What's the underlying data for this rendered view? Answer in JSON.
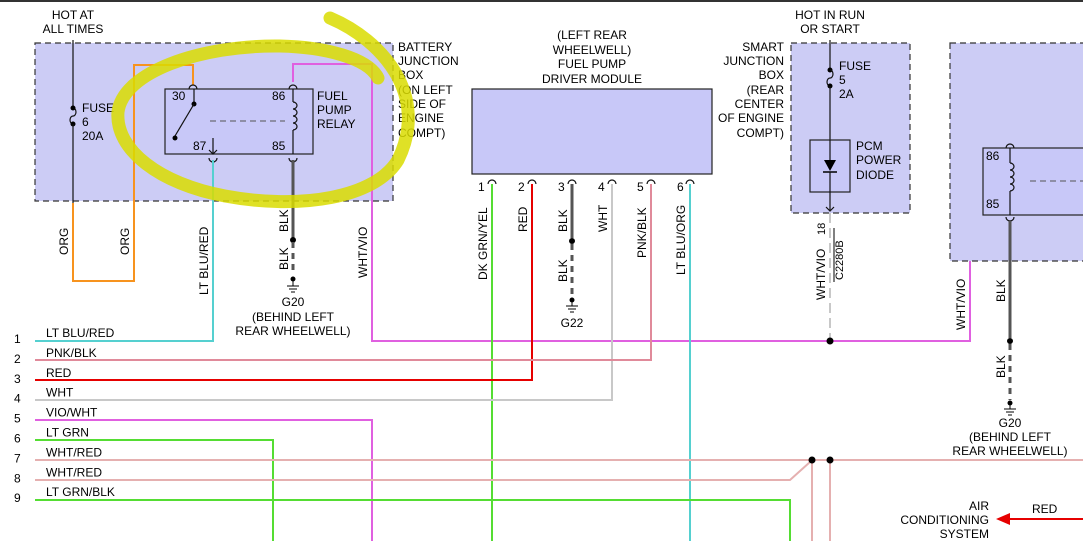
{
  "colors": {
    "org": "#f7931e",
    "ltblu": "#55d0d0",
    "blk": "#555555",
    "wht": "#c8c8c8",
    "pnk": "#e08a9a",
    "red": "#e60000",
    "vio": "#e060e0",
    "grn": "#55dd33",
    "highlight": "#d9dc00",
    "box": "#ccccf5"
  },
  "labels": {
    "hot_all_times": [
      "HOT AT",
      "ALL TIMES"
    ],
    "bjb": [
      "BATTERY",
      "JUNCTION",
      "BOX",
      "(ON LEFT",
      "SIDE OF",
      "ENGINE",
      "COMPT)"
    ],
    "fuse6": [
      "FUSE",
      "6",
      "20A"
    ],
    "relay_pins": {
      "p30": "30",
      "p87": "87",
      "p86": "86",
      "p85": "85"
    },
    "relay_name": [
      "FUEL",
      "PUMP",
      "RELAY"
    ],
    "fpdm": [
      "(LEFT REAR",
      "WHEELWELL)",
      "FUEL PUMP",
      "DRIVER MODULE"
    ],
    "fpdm_pins": [
      "1",
      "2",
      "3",
      "4",
      "5",
      "6"
    ],
    "fpdm_wires": [
      "DK GRN/YEL",
      "RED",
      "BLK",
      "WHT",
      "PNK/BLK",
      "LT BLU/ORG"
    ],
    "blk_g22": "BLK",
    "g22": "G22",
    "hot_run_start": [
      "HOT IN RUN",
      "OR START"
    ],
    "sjb": [
      "SMART",
      "JUNCTION",
      "BOX",
      "(REAR",
      "CENTER",
      "OF ENGINE",
      "COMPT)"
    ],
    "fuse5": [
      "FUSE",
      "5",
      "2A"
    ],
    "pcm_diode": [
      "PCM",
      "POWER",
      "DIODE"
    ],
    "pin18": "18",
    "conn": "C2280B",
    "wht_vio": "WHT/VIO",
    "org": "ORG",
    "lt_blu_red": "LT BLU/RED",
    "blk": "BLK",
    "g20": "G20",
    "behind_left": "(BEHIND LEFT",
    "rear_wheelwell": "REAR WHEELWELL)",
    "rear_wheelwell_r": "REAR WHEELWELL)",
    "right_pins": {
      "p86": "86",
      "p85": "85"
    },
    "air_cond": [
      "AIR",
      "CONDITIONING",
      "SYSTEM"
    ],
    "red": "RED"
  },
  "harness": [
    {
      "num": "1",
      "name": "LT BLU/RED",
      "color": "#55d0d0"
    },
    {
      "num": "2",
      "name": "PNK/BLK",
      "color": "#e08a9a"
    },
    {
      "num": "3",
      "name": "RED",
      "color": "#e60000"
    },
    {
      "num": "4",
      "name": "WHT",
      "color": "#c8c8c8"
    },
    {
      "num": "5",
      "name": "VIO/WHT",
      "color": "#e060e0"
    },
    {
      "num": "6",
      "name": "LT GRN",
      "color": "#55dd33"
    },
    {
      "num": "7",
      "name": "WHT/RED",
      "color": "#e5b0b0"
    },
    {
      "num": "8",
      "name": "WHT/RED",
      "color": "#e5b0b0"
    },
    {
      "num": "9",
      "name": "LT GRN/BLK",
      "color": "#55dd33"
    }
  ]
}
